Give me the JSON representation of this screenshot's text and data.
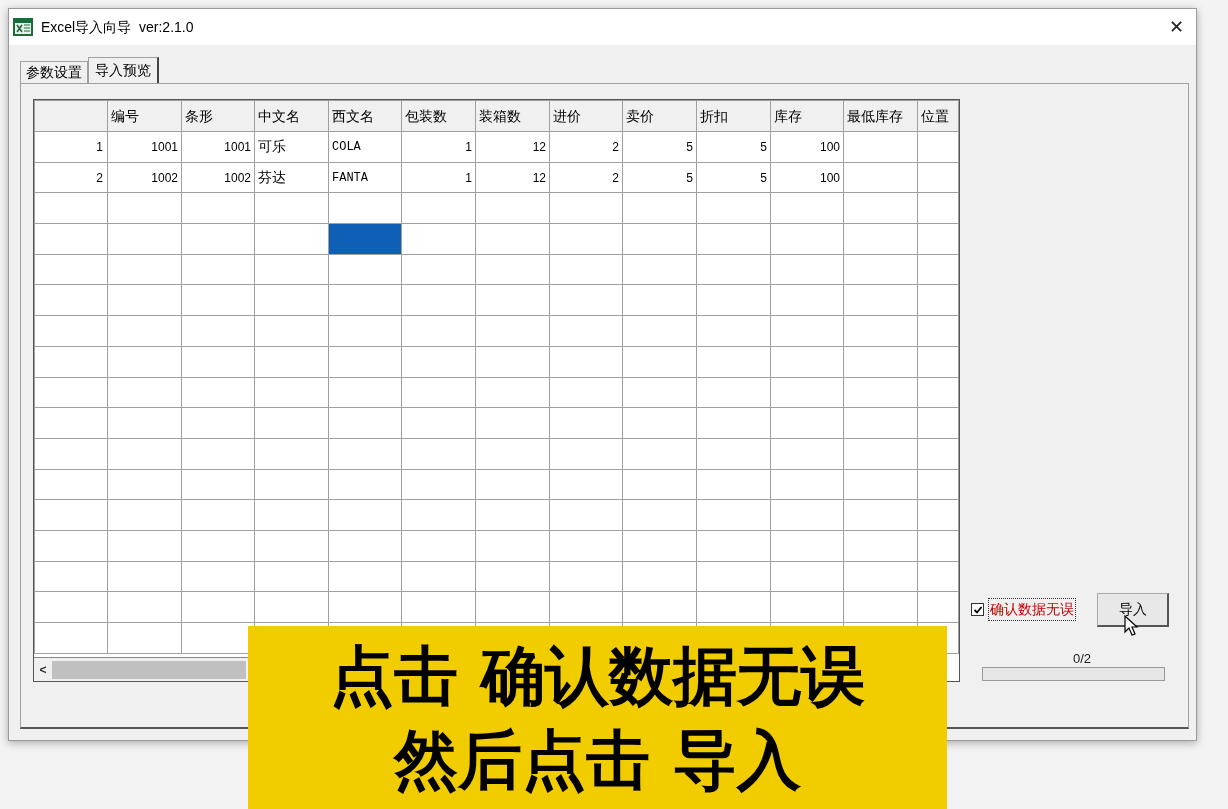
{
  "window": {
    "title": "Excel导入向导  ver:2.1.0",
    "close": "✕"
  },
  "tabs": [
    {
      "label": "参数设置",
      "selected": false
    },
    {
      "label": "导入预览",
      "selected": true
    }
  ],
  "table": {
    "columns": [
      "编号",
      "条形",
      "中文名",
      "西文名",
      "包装数",
      "装箱数",
      "进价",
      "卖价",
      "折扣",
      "库存",
      "最低库存",
      "位置"
    ],
    "rows": [
      {
        "header": "1",
        "cells": [
          "1001",
          "1001",
          "可乐",
          "COLA",
          "1",
          "12",
          "2",
          "5",
          "5",
          "100",
          null,
          null
        ]
      },
      {
        "header": "2",
        "cells": [
          "1002",
          "1002",
          "芬达",
          "FANTA",
          "1",
          "12",
          "2",
          "5",
          "5",
          "100",
          null,
          null
        ]
      },
      {
        "header": null,
        "cells": [
          null,
          null,
          null,
          null,
          null,
          null,
          null,
          null,
          null,
          null,
          null,
          null
        ]
      },
      {
        "header": null,
        "cells": [
          null,
          null,
          null,
          {
            "selected": true
          },
          null,
          null,
          null,
          null,
          null,
          null,
          null,
          null
        ]
      },
      {
        "header": null,
        "cells": [
          null,
          null,
          null,
          null,
          null,
          null,
          null,
          null,
          null,
          null,
          null,
          null
        ]
      },
      {
        "header": null,
        "cells": [
          null,
          null,
          null,
          null,
          null,
          null,
          null,
          null,
          null,
          null,
          null,
          null
        ]
      },
      {
        "header": null,
        "cells": [
          null,
          null,
          null,
          null,
          null,
          null,
          null,
          null,
          null,
          null,
          null,
          null
        ]
      },
      {
        "header": null,
        "cells": [
          null,
          null,
          null,
          null,
          null,
          null,
          null,
          null,
          null,
          null,
          null,
          null
        ]
      },
      {
        "header": null,
        "cells": [
          null,
          null,
          null,
          null,
          null,
          null,
          null,
          null,
          null,
          null,
          null,
          null
        ]
      },
      {
        "header": null,
        "cells": [
          null,
          null,
          null,
          null,
          null,
          null,
          null,
          null,
          null,
          null,
          null,
          null
        ]
      },
      {
        "header": null,
        "cells": [
          null,
          null,
          null,
          null,
          null,
          null,
          null,
          null,
          null,
          null,
          null,
          null
        ]
      },
      {
        "header": null,
        "cells": [
          null,
          null,
          null,
          null,
          null,
          null,
          null,
          null,
          null,
          null,
          null,
          null
        ]
      },
      {
        "header": null,
        "cells": [
          null,
          null,
          null,
          null,
          null,
          null,
          null,
          null,
          null,
          null,
          null,
          null
        ]
      },
      {
        "header": null,
        "cells": [
          null,
          null,
          null,
          null,
          null,
          null,
          null,
          null,
          null,
          null,
          null,
          null
        ]
      },
      {
        "header": null,
        "cells": [
          null,
          null,
          null,
          null,
          null,
          null,
          null,
          null,
          null,
          null,
          null,
          null
        ]
      },
      {
        "header": null,
        "cells": [
          null,
          null,
          null,
          null,
          null,
          null,
          null,
          null,
          null,
          null,
          null,
          null
        ]
      },
      {
        "header": null,
        "cells": [
          null,
          null,
          null,
          null,
          null,
          null,
          null,
          null,
          null,
          null,
          null,
          null
        ]
      }
    ],
    "scroll_left": "<"
  },
  "confirm": {
    "label": "确认数据无误",
    "checked": true
  },
  "import_button": "导入",
  "progress": {
    "reading": "0/2",
    "level": 0
  },
  "caption": [
    "点击 确认数据无误",
    "然后点击 导入"
  ]
}
